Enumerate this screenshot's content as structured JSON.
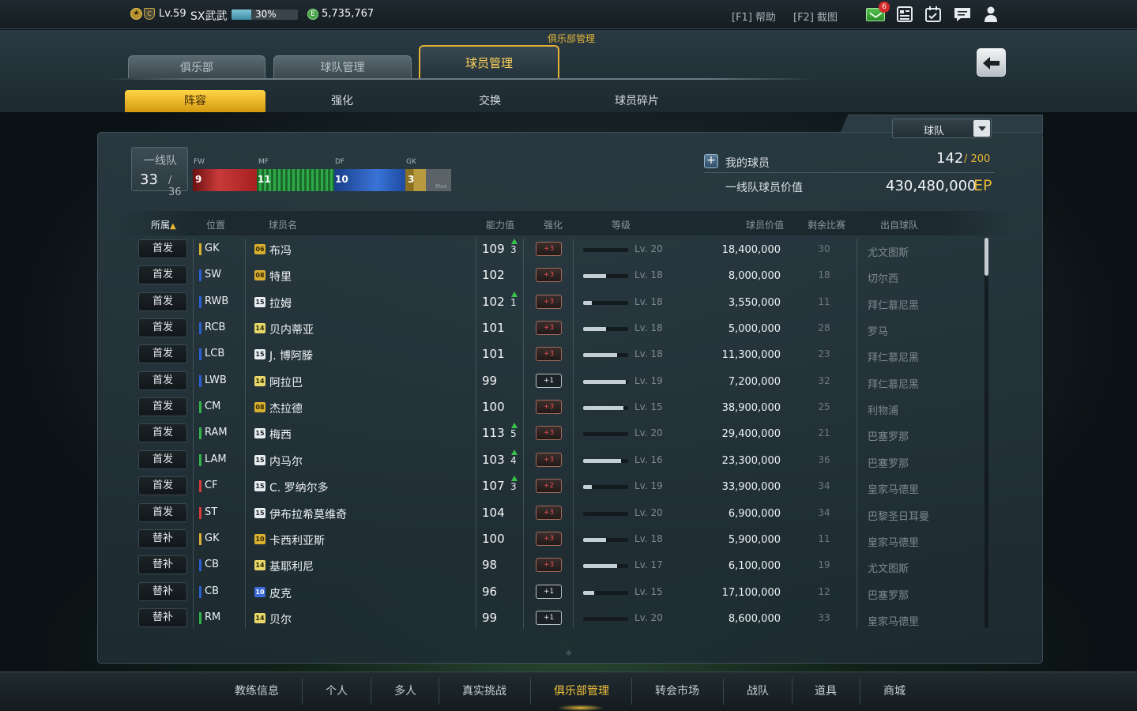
{
  "topbar": {
    "badge_star": "★",
    "badge_c": "C",
    "level": "Lv.59",
    "username": "SX武武",
    "xp_percent_text": "30%",
    "xp_fraction": 0.3,
    "coin_symbol": "E",
    "money": "5,735,767",
    "help": "[F1] 帮助",
    "screenshot": "[F2] 截图",
    "mail_count": "6",
    "icons": [
      "mail-icon",
      "document-icon",
      "calendar-check-icon",
      "chat-icon",
      "user-icon"
    ]
  },
  "header": {
    "section_title": "俱乐部管理",
    "tabs": [
      "俱乐部",
      "球队管理",
      "球员管理"
    ],
    "subtabs": [
      "阵容",
      "强化",
      "交换",
      "球员碎片"
    ]
  },
  "filter": {
    "dropdown_value": "球队"
  },
  "first_team": {
    "label": "一线队",
    "count": "33",
    "total": "/ 36",
    "positions": [
      {
        "label": "FW",
        "count": "9",
        "color": "#c83a3a"
      },
      {
        "label": "MF",
        "count": "11",
        "color": "#2ea84a"
      },
      {
        "label": "DF",
        "count": "10",
        "color": "#3a74d8"
      },
      {
        "label": "GK",
        "count": "3",
        "color": "#b89a40"
      }
    ],
    "max_label": "Max"
  },
  "summary": {
    "plus": "+",
    "my_players_label": "我的球员",
    "player_count": "142",
    "player_cap": "/ 200",
    "value_label": "一线队球员价值",
    "value_amount": "430,480,000",
    "value_unit": "EP"
  },
  "table": {
    "headers": {
      "owner": "所属",
      "owner_sort": "▲",
      "position": "位置",
      "name": "球员名",
      "ovr": "能力值",
      "enhance": "强化",
      "level": "等级",
      "value": "球员价值",
      "remaining": "剩余比赛",
      "club": "出自球队"
    },
    "rows": [
      {
        "status": "首发",
        "pos": "GK",
        "pos_color": "#d8b030",
        "season": "06",
        "season_style": "gold",
        "name": "布冯",
        "ovr": "109",
        "up": "3",
        "enh": "+3",
        "enh_style": "red",
        "lv_fill": 0.0,
        "lv": "Lv. 20",
        "value": "18,400,000",
        "remaining": "30",
        "club": "尤文图斯"
      },
      {
        "status": "首发",
        "pos": "SW",
        "pos_color": "#2a5fd0",
        "season": "08",
        "season_style": "gold",
        "name": "特里",
        "ovr": "102",
        "up": "",
        "enh": "+3",
        "enh_style": "red",
        "lv_fill": 0.5,
        "lv": "Lv. 18",
        "value": "8,000,000",
        "remaining": "18",
        "club": "切尔西"
      },
      {
        "status": "首发",
        "pos": "RWB",
        "pos_color": "#2a5fd0",
        "season": "15",
        "season_style": "white",
        "name": "拉姆",
        "ovr": "102",
        "up": "1",
        "enh": "+3",
        "enh_style": "red",
        "lv_fill": 0.2,
        "lv": "Lv. 18",
        "value": "3,550,000",
        "remaining": "11",
        "club": "拜仁慕尼黑"
      },
      {
        "status": "首发",
        "pos": "RCB",
        "pos_color": "#2a5fd0",
        "season": "14",
        "season_style": "yellow",
        "name": "贝内蒂亚",
        "ovr": "101",
        "up": "",
        "enh": "+3",
        "enh_style": "red",
        "lv_fill": 0.5,
        "lv": "Lv. 18",
        "value": "5,000,000",
        "remaining": "28",
        "club": "罗马"
      },
      {
        "status": "首发",
        "pos": "LCB",
        "pos_color": "#2a5fd0",
        "season": "15",
        "season_style": "white",
        "name": "J. 博阿滕",
        "ovr": "101",
        "up": "",
        "enh": "+3",
        "enh_style": "red",
        "lv_fill": 0.75,
        "lv": "Lv. 18",
        "value": "11,300,000",
        "remaining": "23",
        "club": "拜仁慕尼黑"
      },
      {
        "status": "首发",
        "pos": "LWB",
        "pos_color": "#2a5fd0",
        "season": "14",
        "season_style": "yellow",
        "name": "阿拉巴",
        "ovr": "99",
        "up": "",
        "enh": "+1",
        "enh_style": "white",
        "lv_fill": 0.95,
        "lv": "Lv. 19",
        "value": "7,200,000",
        "remaining": "32",
        "club": "拜仁慕尼黑"
      },
      {
        "status": "首发",
        "pos": "CM",
        "pos_color": "#33b24a",
        "season": "08",
        "season_style": "gold",
        "name": "杰拉德",
        "ovr": "100",
        "up": "",
        "enh": "+3",
        "enh_style": "red",
        "lv_fill": 0.9,
        "lv": "Lv. 15",
        "value": "38,900,000",
        "remaining": "25",
        "club": "利物浦"
      },
      {
        "status": "首发",
        "pos": "RAM",
        "pos_color": "#33b24a",
        "season": "15",
        "season_style": "white",
        "name": "梅西",
        "ovr": "113",
        "up": "5",
        "enh": "+3",
        "enh_style": "red",
        "lv_fill": 0.0,
        "lv": "Lv. 20",
        "value": "29,400,000",
        "remaining": "21",
        "club": "巴塞罗那"
      },
      {
        "status": "首发",
        "pos": "LAM",
        "pos_color": "#33b24a",
        "season": "15",
        "season_style": "white",
        "name": "内马尔",
        "ovr": "103",
        "up": "4",
        "enh": "+3",
        "enh_style": "red",
        "lv_fill": 0.85,
        "lv": "Lv. 16",
        "value": "23,300,000",
        "remaining": "36",
        "club": "巴塞罗那"
      },
      {
        "status": "首发",
        "pos": "CF",
        "pos_color": "#d83a3a",
        "season": "15",
        "season_style": "white",
        "name": "C. 罗纳尔多",
        "ovr": "107",
        "up": "3",
        "enh": "+2",
        "enh_style": "red",
        "lv_fill": 0.2,
        "lv": "Lv. 19",
        "value": "33,900,000",
        "remaining": "34",
        "club": "皇家马德里"
      },
      {
        "status": "首发",
        "pos": "ST",
        "pos_color": "#d83a3a",
        "season": "15",
        "season_style": "white",
        "name": "伊布拉希莫维奇",
        "ovr": "104",
        "up": "",
        "enh": "+3",
        "enh_style": "red",
        "lv_fill": 0.0,
        "lv": "Lv. 20",
        "value": "6,900,000",
        "remaining": "34",
        "club": "巴黎圣日耳曼"
      },
      {
        "status": "替补",
        "pos": "GK",
        "pos_color": "#d8b030",
        "season": "10",
        "season_style": "gold",
        "name": "卡西利亚斯",
        "ovr": "100",
        "up": "",
        "enh": "+3",
        "enh_style": "red",
        "lv_fill": 0.5,
        "lv": "Lv. 18",
        "value": "5,900,000",
        "remaining": "11",
        "club": "皇家马德里"
      },
      {
        "status": "替补",
        "pos": "CB",
        "pos_color": "#2a5fd0",
        "season": "14",
        "season_style": "yellow",
        "name": "基耶利尼",
        "ovr": "98",
        "up": "",
        "enh": "+3",
        "enh_style": "red",
        "lv_fill": 0.75,
        "lv": "Lv. 17",
        "value": "6,100,000",
        "remaining": "19",
        "club": "尤文图斯"
      },
      {
        "status": "替补",
        "pos": "CB",
        "pos_color": "#2a5fd0",
        "season": "10",
        "season_style": "blue",
        "name": "皮克",
        "ovr": "96",
        "up": "",
        "enh": "+1",
        "enh_style": "white",
        "lv_fill": 0.25,
        "lv": "Lv. 15",
        "value": "17,100,000",
        "remaining": "12",
        "club": "巴塞罗那"
      },
      {
        "status": "替补",
        "pos": "RM",
        "pos_color": "#33b24a",
        "season": "14",
        "season_style": "yellow",
        "name": "贝尔",
        "ovr": "99",
        "up": "",
        "enh": "+1",
        "enh_style": "white",
        "lv_fill": 0.0,
        "lv": "Lv. 20",
        "value": "8,600,000",
        "remaining": "33",
        "club": "皇家马德里"
      }
    ]
  },
  "bottom_nav": [
    "教练信息",
    "个人",
    "多人",
    "真实挑战",
    "俱乐部管理",
    "转会市场",
    "战队",
    "道具",
    "商城"
  ],
  "bottom_nav_active": "俱乐部管理",
  "colors": {
    "accent": "#f3c43b",
    "gold_tab": "#ffd447"
  }
}
